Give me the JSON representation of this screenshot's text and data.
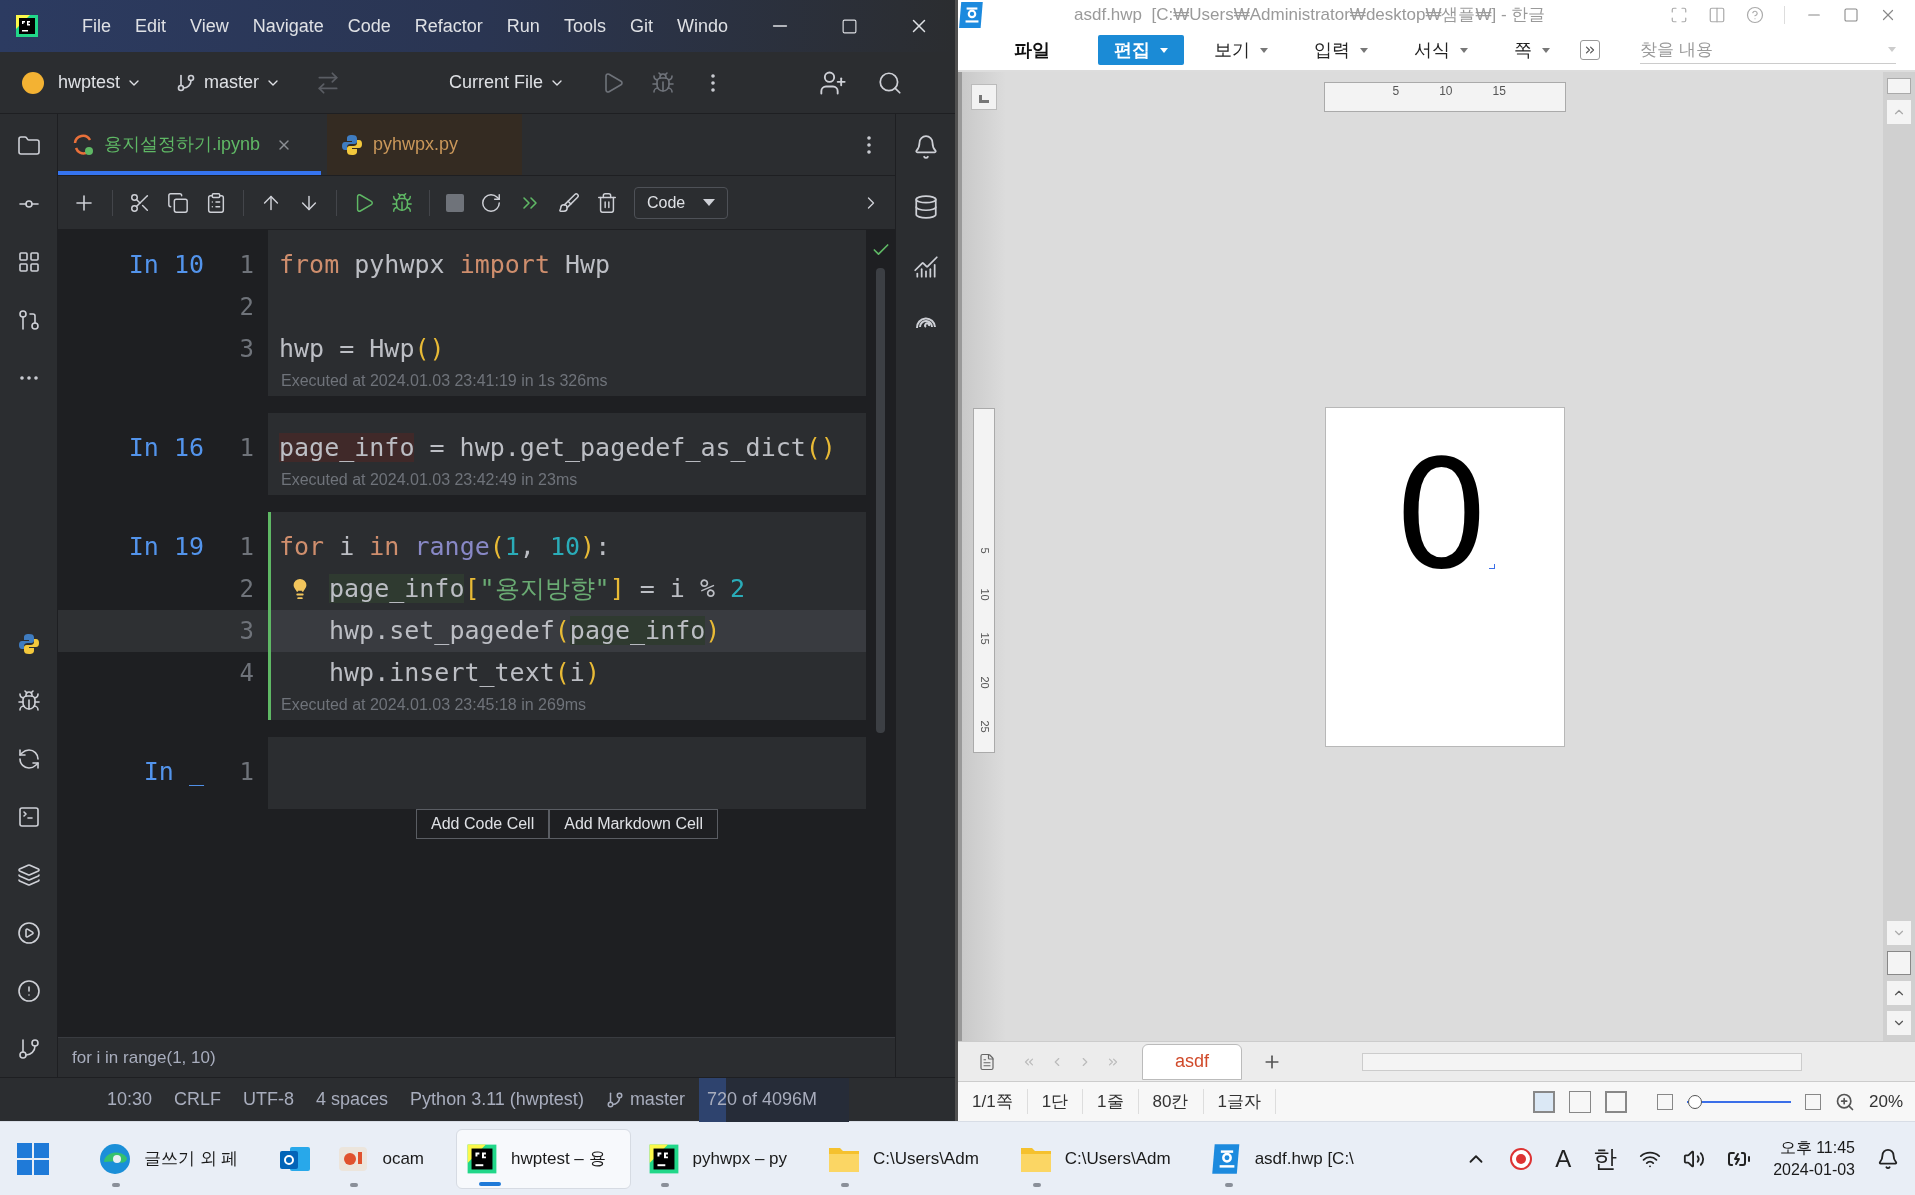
{
  "ide": {
    "menu": [
      "File",
      "Edit",
      "View",
      "Navigate",
      "Code",
      "Refactor",
      "Run",
      "Tools",
      "Git",
      "Windo"
    ],
    "project": "hwptest",
    "branch": "master",
    "run_config": "Current File",
    "tabs": [
      {
        "label": "용지설정하기.ipynb",
        "kind": "notebook",
        "selected": true
      },
      {
        "label": "pyhwpx.py",
        "kind": "python",
        "selected": false
      }
    ],
    "cell_type": "Code",
    "cells": [
      {
        "prompt": "In 10",
        "selected": false,
        "executed": "Executed at 2024.01.03 23:41:19 in 1s 326ms",
        "lines": [
          {
            "number": "1",
            "current": false,
            "indented": false,
            "bulb": false,
            "tokens": [
              {
                "text": "from",
                "kind": "keyword"
              },
              {
                "text": " pyhwpx ",
                "kind": "name"
              },
              {
                "text": "import",
                "kind": "keyword"
              },
              {
                "text": " Hwp",
                "kind": "name"
              }
            ]
          },
          {
            "number": "2",
            "current": false,
            "bulb": false
          },
          {
            "number": "3",
            "current": false,
            "indented": false,
            "bulb": false,
            "tokens": [
              {
                "text": "hwp = Hwp",
                "kind": "name"
              },
              {
                "text": "()",
                "kind": "paren"
              }
            ]
          }
        ]
      },
      {
        "prompt": "In 16",
        "selected": false,
        "executed": "Executed at 2024.01.03 23:42:49 in 23ms",
        "lines": [
          {
            "number": "1",
            "current": false,
            "indented": false,
            "bulb": false,
            "tokens": [
              {
                "text": "page_info",
                "kind": "write"
              },
              {
                "text": " = hwp.get_pagedef_as_dict",
                "kind": "name"
              },
              {
                "text": "()",
                "kind": "paren"
              }
            ]
          }
        ]
      },
      {
        "prompt": "In 19",
        "selected": true,
        "executed": "Executed at 2024.01.03 23:45:18 in 269ms",
        "lines": [
          {
            "number": "1",
            "current": false,
            "indented": false,
            "bulb": false,
            "tokens": [
              {
                "text": "for",
                "kind": "keyword"
              },
              {
                "text": " i ",
                "kind": "name"
              },
              {
                "text": "in",
                "kind": "keyword"
              },
              {
                "text": " range",
                "kind": "builtin"
              },
              {
                "text": "(",
                "kind": "paren"
              },
              {
                "text": "1",
                "kind": "number"
              },
              {
                "text": ", ",
                "kind": "name"
              },
              {
                "text": "10",
                "kind": "number"
              },
              {
                "text": ")",
                "kind": "paren"
              },
              {
                "text": ":",
                "kind": "name"
              }
            ]
          },
          {
            "number": "2",
            "current": false,
            "indented": true,
            "bulb": true,
            "tokens": [
              {
                "text": "page_info",
                "kind": "read"
              },
              {
                "text": "[",
                "kind": "paren"
              },
              {
                "text": "\"용지방향\"",
                "kind": "string"
              },
              {
                "text": "]",
                "kind": "paren"
              },
              {
                "text": " = i % ",
                "kind": "name"
              },
              {
                "text": "2",
                "kind": "number"
              }
            ]
          },
          {
            "number": "3",
            "current": true,
            "indented": true,
            "bulb": false,
            "tokens": [
              {
                "text": "hwp.set_pagedef",
                "kind": "name"
              },
              {
                "text": "(",
                "kind": "paren"
              },
              {
                "text": "page_info",
                "kind": "read"
              },
              {
                "text": ")",
                "kind": "paren"
              }
            ]
          },
          {
            "number": "4",
            "current": false,
            "indented": true,
            "bulb": false,
            "tokens": [
              {
                "text": "hwp.insert_text",
                "kind": "name"
              },
              {
                "text": "(",
                "kind": "paren"
              },
              {
                "text": "i",
                "kind": "name"
              },
              {
                "text": ")",
                "kind": "paren"
              }
            ]
          }
        ]
      },
      {
        "prompt": "In _",
        "selected": false,
        "lines": [
          {
            "number": "1",
            "current": false,
            "bulb": false
          }
        ]
      }
    ],
    "add_buttons": [
      "Add Code Cell",
      "Add Markdown Cell"
    ],
    "hint": "for i in range(1, 10)",
    "status_bar": {
      "items": [
        "10:30",
        "CRLF",
        "UTF-8",
        "4 spaces",
        "Python 3.11 (hwptest)"
      ],
      "branch": "master",
      "memory": {
        "text": "720 of 4096M",
        "level": 0.18
      }
    }
  },
  "hwp": {
    "title": "asdf.hwp  [C:₩Users₩Administrator₩desktop₩샘플₩] - 한글",
    "menus": [
      {
        "label": "파일",
        "kind": "plain",
        "selected": false
      },
      {
        "label": "편집",
        "kind": "dropdown",
        "selected": true
      },
      {
        "label": "보기",
        "kind": "dropdown",
        "selected": false
      },
      {
        "label": "입력",
        "kind": "dropdown",
        "selected": false
      },
      {
        "label": "서식",
        "kind": "dropdown",
        "selected": false
      },
      {
        "label": "쪽",
        "kind": "dropdown",
        "selected": false
      }
    ],
    "search": {
      "placeholder": "찾을 내용"
    },
    "ruler_h": [
      "5",
      "10",
      "15"
    ],
    "ruler_v": [
      "5",
      "10",
      "15",
      "20",
      "25"
    ],
    "page_text": "0",
    "sheet_tabs": [
      {
        "label": "asdf",
        "selected": true
      }
    ],
    "status": [
      "1/1쪽",
      "1단",
      "1줄",
      "80칸",
      "1글자"
    ],
    "zoom": {
      "level": 0.08,
      "text": "20%"
    }
  },
  "taskbar": {
    "items": [
      {
        "kind": "edge",
        "label": "글쓰기 외 페",
        "selected": false,
        "running": true
      },
      {
        "kind": "outlook",
        "selected": false,
        "running": false
      },
      {
        "kind": "ocam",
        "label": "ocam",
        "selected": false,
        "running": true
      },
      {
        "kind": "pycharm",
        "label": "hwptest – 용",
        "selected": true,
        "running": true
      },
      {
        "kind": "pycharm",
        "label": "pyhwpx – py",
        "selected": false,
        "running": true
      },
      {
        "kind": "folder",
        "label": "C:\\Users\\Adm",
        "selected": false,
        "running": true
      },
      {
        "kind": "folder",
        "label": "C:\\Users\\Adm",
        "selected": false,
        "running": true
      },
      {
        "kind": "hwp",
        "label": "asdf.hwp [C:\\",
        "selected": false,
        "running": true
      }
    ],
    "tray_texts": [
      "A",
      "한"
    ],
    "time": "오후 11:45",
    "date": "2024-01-03"
  }
}
